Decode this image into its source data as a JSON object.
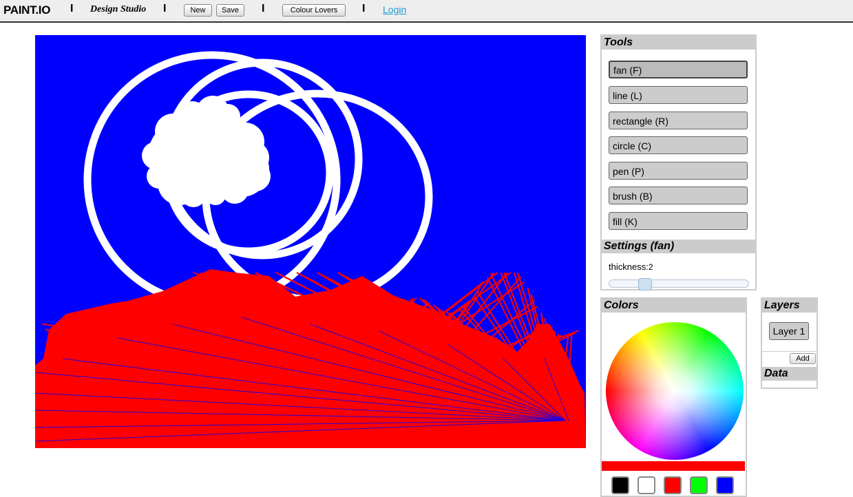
{
  "header": {
    "brand": "PAINT.IO",
    "studio": "Design Studio",
    "separator": "I",
    "new_label": "New",
    "save_label": "Save",
    "colour_lovers_label": "Colour Lovers",
    "login_label": "Login"
  },
  "tools": {
    "title": "Tools",
    "items": [
      {
        "label": "fan (F)",
        "active": true
      },
      {
        "label": "line (L)"
      },
      {
        "label": "rectangle (R)"
      },
      {
        "label": "circle (C)"
      },
      {
        "label": "pen (P)"
      },
      {
        "label": "brush (B)"
      },
      {
        "label": "fill (K)"
      }
    ]
  },
  "settings": {
    "title": "Settings (fan)",
    "thickness_label": "thickness:",
    "thickness_value": "2"
  },
  "colors": {
    "title": "Colors",
    "current": "#ff0000",
    "swatches": [
      "#000000",
      "#ffffff",
      "#ff0000",
      "#00ff00",
      "#0000ff"
    ]
  },
  "layers": {
    "title": "Layers",
    "layer_label": "Layer 1",
    "add_label": "Add",
    "data_title": "Data"
  },
  "canvas": {
    "background": "#0000ff",
    "stroke_white": "#ffffff",
    "stroke_red": "#ff0000"
  }
}
